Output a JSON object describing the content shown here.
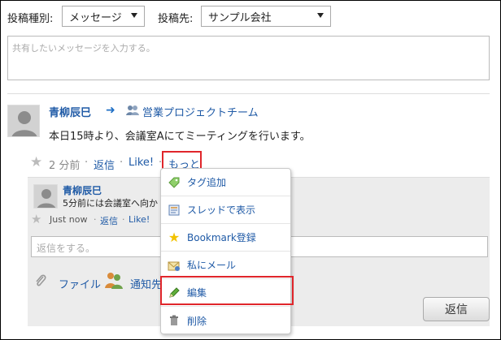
{
  "filter": {
    "type_label": "投稿種別:",
    "type_value": "メッセージ",
    "dest_label": "投稿先:",
    "dest_value": "サンプル会社"
  },
  "compose": {
    "placeholder": "共有したいメッセージを入力する。"
  },
  "post": {
    "author": "青柳辰巳",
    "group": "営業プロジェクトチーム",
    "body": "本日15時より、会議室Aにてミーティングを行います。",
    "time": "2 分前",
    "reply": "返信",
    "like": "Like!",
    "more": "もっと",
    "dot": "·"
  },
  "reply_item": {
    "author": "青柳辰巳",
    "body": "5分前には会議室へ向か",
    "time": "Just now",
    "reply": "返信",
    "like": "Like!",
    "dot": "·"
  },
  "reply_box": {
    "placeholder": "返信をする。",
    "file": "ファイル",
    "notify": "通知先",
    "submit": "返信"
  },
  "menu": {
    "items": [
      {
        "label": "タグ追加"
      },
      {
        "label": "スレッドで表示"
      },
      {
        "label": "Bookmark登録"
      },
      {
        "label": "私にメール"
      },
      {
        "label": "編集"
      },
      {
        "label": "削除"
      }
    ]
  },
  "colors": {
    "link": "#1f5aa6",
    "highlight": "#e0262b"
  }
}
